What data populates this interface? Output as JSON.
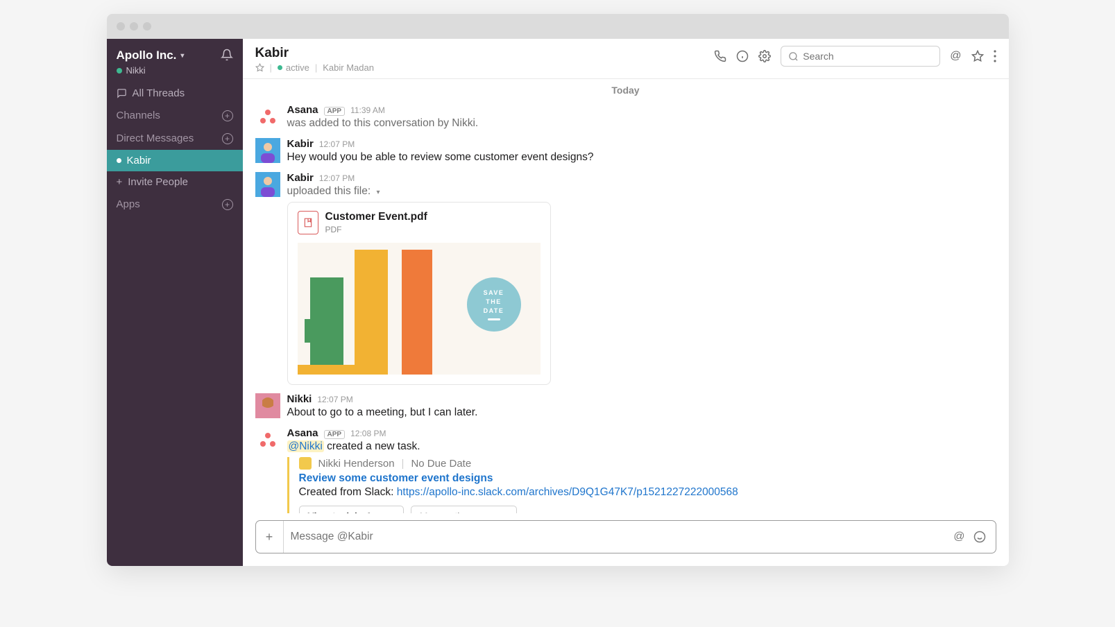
{
  "sidebar": {
    "workspace": "Apollo Inc.",
    "user": "Nikki",
    "allThreads": "All Threads",
    "channels": "Channels",
    "directMessages": "Direct Messages",
    "dmItems": [
      "Kabir"
    ],
    "invite": "Invite People",
    "apps": "Apps"
  },
  "header": {
    "title": "Kabir",
    "status": "active",
    "fullName": "Kabir Madan",
    "searchPlaceholder": "Search"
  },
  "dateDivider": "Today",
  "messages": {
    "m1": {
      "author": "Asana",
      "badge": "APP",
      "time": "11:39 AM",
      "text": "was added to this conversation by Nikki."
    },
    "m2": {
      "author": "Kabir",
      "time": "12:07 PM",
      "text": "Hey would you be able to review some customer event designs?"
    },
    "m3": {
      "author": "Kabir",
      "time": "12:07 PM",
      "uploadedText": "uploaded this file:",
      "fileName": "Customer Event.pdf",
      "fileType": "PDF",
      "saveTheDate": "SAVE THE DATE"
    },
    "m4": {
      "author": "Nikki",
      "time": "12:07 PM",
      "text": "About to go to a meeting, but I can later."
    },
    "m5": {
      "author": "Asana",
      "badge": "APP",
      "time": "12:08 PM",
      "mention": "@Nikki",
      "afterMention": " created a new task.",
      "assignee": "Nikki Henderson",
      "due": "No Due Date",
      "taskTitle": "Review some customer event designs",
      "createdPrefix": "Created from Slack: ",
      "link": "https://apollo-inc.slack.com/archives/D9Q1G47K7/p1521227222000568",
      "viewTask": "View task in Asana",
      "moreActions": "More actions..."
    }
  },
  "composer": {
    "placeholder": "Message @Kabir"
  }
}
